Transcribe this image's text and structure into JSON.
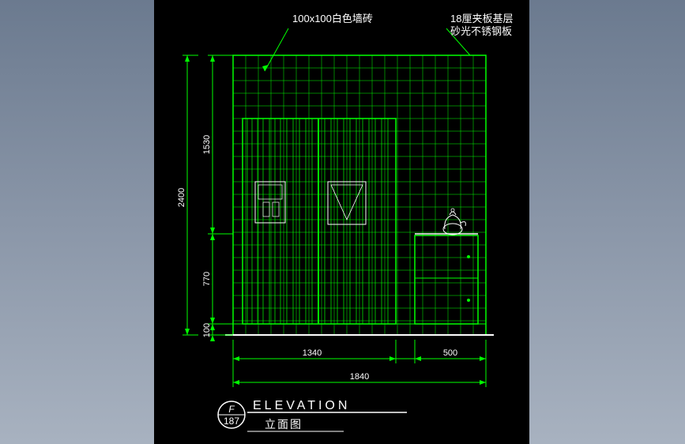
{
  "labels": {
    "tile": "100x100白色墙砖",
    "panel_line1": "18厘夹板基层",
    "panel_line2": "砂光不锈钢板"
  },
  "dimensions": {
    "height_total": "2400",
    "height_upper": "1530",
    "height_mid": "770",
    "height_base": "100",
    "width_fridge": "1340",
    "width_cabinet": "500",
    "width_total": "1840"
  },
  "title": {
    "tag_letter": "F",
    "tag_number": "187",
    "main": "ELEVATION",
    "sub": "立面图"
  }
}
